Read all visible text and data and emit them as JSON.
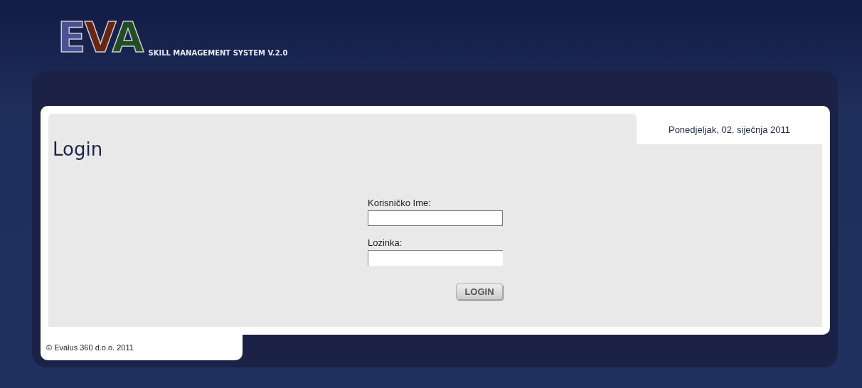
{
  "header": {
    "logo": "EVA",
    "subtitle": "SKILL MANAGEMENT SYSTEM V.2.0"
  },
  "date": "Ponedjeljak, 02. siječnja 2011",
  "page_title": "Login",
  "form": {
    "fields": [
      {
        "label": "Korisničko Ime:",
        "kind": "text"
      },
      {
        "label": "Lozinka:",
        "kind": "password"
      }
    ],
    "submit": "LOGIN"
  },
  "footer": "© Evalus 360 d.o.o. 2011"
}
